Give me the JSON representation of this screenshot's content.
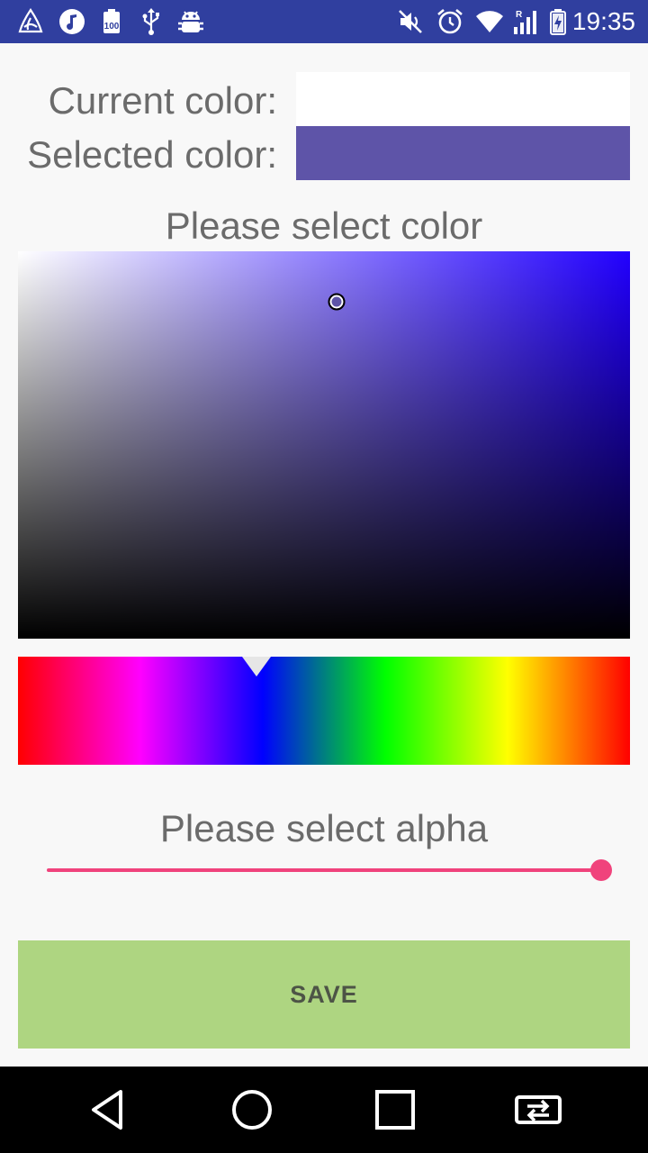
{
  "status_bar": {
    "time": "19:35",
    "left_icons": [
      "triforce-icon",
      "music-icon",
      "battery-100-icon",
      "usb-icon",
      "android-debug-icon"
    ],
    "right_icons": [
      "mute-icon",
      "alarm-icon",
      "wifi-icon",
      "signal-roaming-icon",
      "battery-charging-icon"
    ]
  },
  "colors": {
    "current_label": "Current color:",
    "selected_label": "Selected color:",
    "current_color": "#ffffff",
    "selected_color": "#5e54a8",
    "hue_color": "#2200ff"
  },
  "picker": {
    "title": "Please select color",
    "saturation": 0.52,
    "value": 0.87,
    "hue_fraction": 0.39
  },
  "alpha": {
    "title": "Please select alpha",
    "value": 1.0,
    "accent_color": "#f0437c"
  },
  "actions": {
    "save_label": "SAVE",
    "save_color": "#aed581"
  },
  "nav": {
    "icons": [
      "back-icon",
      "home-icon",
      "recents-icon",
      "switch-app-icon"
    ]
  }
}
